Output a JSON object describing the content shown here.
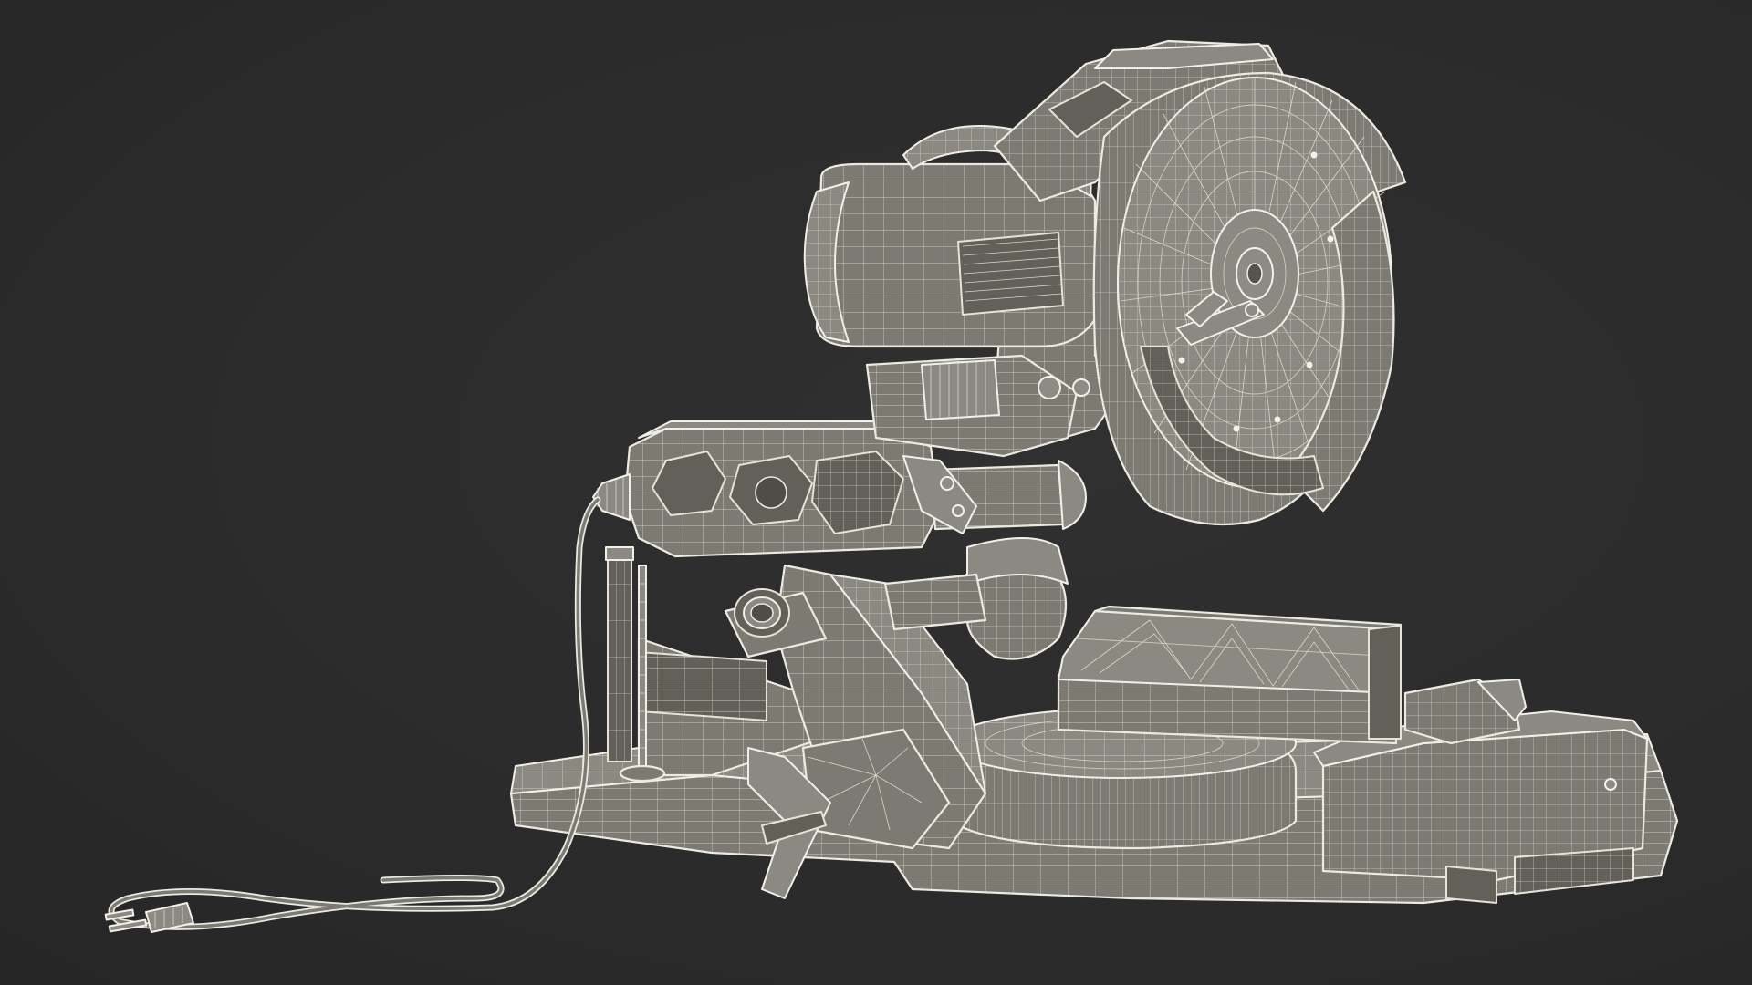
{
  "scene": {
    "background_color": "#2b2b2b",
    "mesh_fill_color": "#7c7a73",
    "wire_color": "#ecebe2",
    "subject_icon": "miter-saw-wireframe-icon"
  }
}
